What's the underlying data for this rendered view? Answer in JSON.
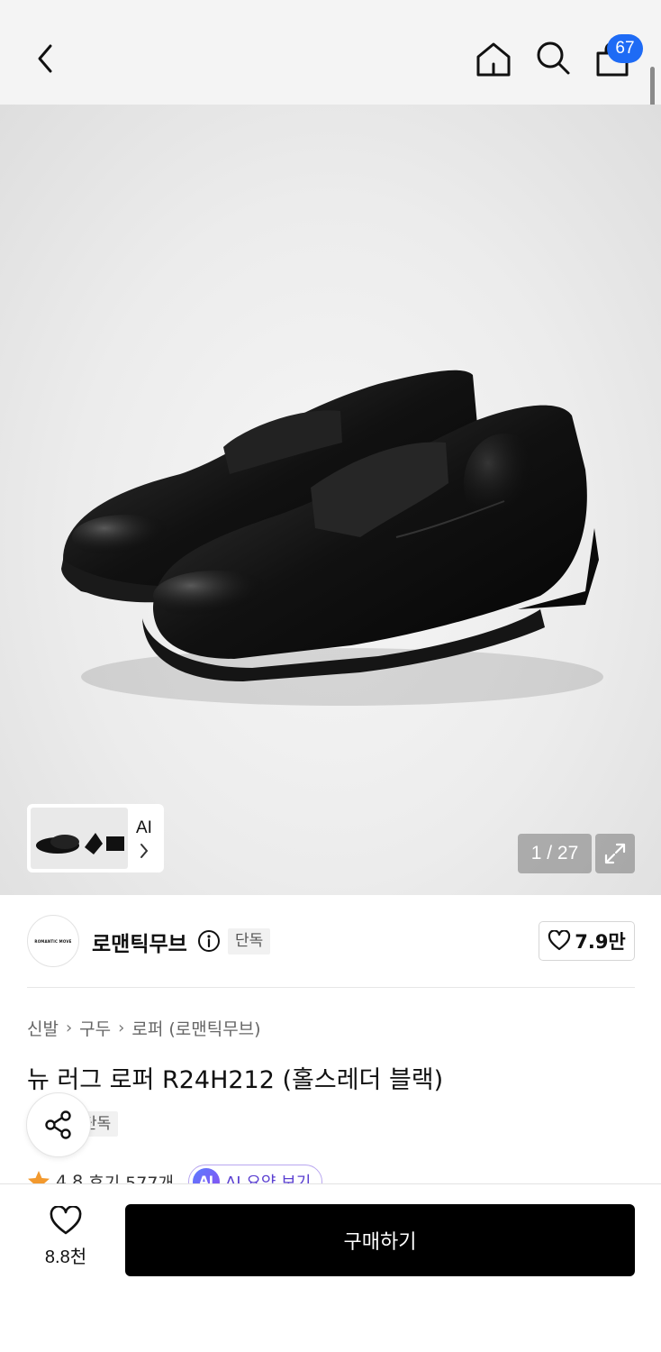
{
  "header": {
    "back_icon": "chevron-left-icon",
    "home_icon": "home-icon",
    "search_icon": "search-icon",
    "cart_icon": "shopping-bag-icon",
    "cart_count": "67",
    "badge_color": "#1e6bf5"
  },
  "gallery": {
    "thumbnail_label": "AI",
    "page_counter": "1 / 27",
    "expand_icon": "expand-icon"
  },
  "brand": {
    "logo_text": "ROMANTIC MOVE",
    "name": "로맨틱무브",
    "info_icon": "info-icon",
    "tag": "단독",
    "like_count": "7.9만"
  },
  "breadcrumb": [
    "신발",
    "구두",
    "로퍼 (로맨틱무브)"
  ],
  "product": {
    "title": "뉴 러그 로퍼 R24H212 (홀스레더 블랙)",
    "tag": "단독",
    "rating": "4.8",
    "reviews": "후기 577개",
    "ai_badge": "AI",
    "ai_summary": "AI 요약 보기"
  },
  "bottom": {
    "wish_count": "8.8천",
    "buy_label": "구매하기"
  }
}
